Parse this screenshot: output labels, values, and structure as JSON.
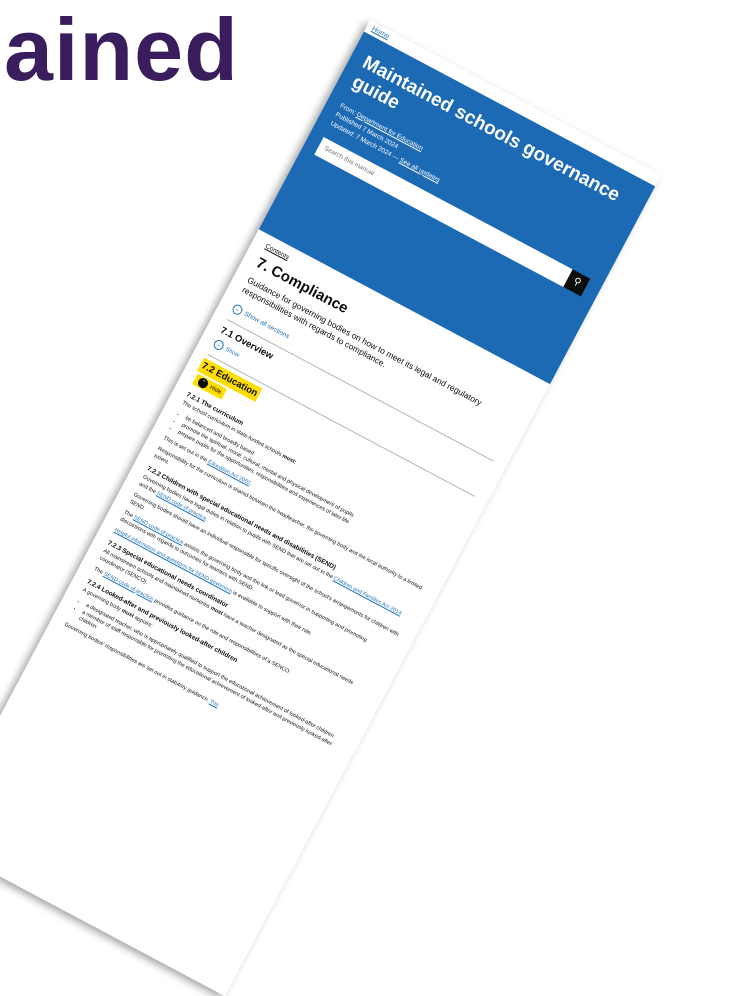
{
  "slide": {
    "title": "ained"
  },
  "page": {
    "home_link": "Home",
    "banner": {
      "title": "Maintained schools governance guide",
      "from_label": "From:",
      "from_org": "Department for Education",
      "published": "Published 7 March 2024",
      "updated_label": "Updated: 7 March 2024 —",
      "see_updates": "See all updates",
      "search_placeholder": "Search this manual"
    },
    "contents_link": "Contents",
    "chapter_title": "7. Compliance",
    "chapter_summary": "Guidance for governing bodies on how to meet its legal and regulatory responsibilities with regards to compliance.",
    "show_all": "Show all sections",
    "sections": [
      {
        "title": "7.1 Overview",
        "control": "Show"
      },
      {
        "title": "7.2 Education",
        "control": "Hide"
      }
    ],
    "s721": {
      "heading": "7.2.1 The curriculum",
      "intro": "The school curriculum in state-funded schools ",
      "must": "must:",
      "bullets": [
        "be balanced and broadly based",
        "promote the spiritual, moral, cultural, mental and physical development of pupils",
        "prepare pupils for the opportunities, responsibilities and experiences of later life"
      ],
      "set_out_pre": "This is set out in the ",
      "set_out_link": "Education Act 2002",
      "set_out_post": ".",
      "responsibility": "Responsibility for the curriculum is shared between the headteacher, the governing body and the local authority to a limited extent."
    },
    "s722": {
      "heading": "7.2.2 Children with special educational needs and disabilities (SEND)",
      "p1_pre": "Governing bodies have legal duties in relation to pupils with SEND that are set out in the ",
      "p1_link1": "Children and Families Act 2014",
      "p1_mid": " and the ",
      "p1_link2": "SEND code of practice",
      "p1_post": ".",
      "p2": "Governing bodies should have an individual responsible for specific oversight of the school's arrangements for children with SEND.",
      "p3_pre": "The ",
      "p3_link": "SEND code of practice",
      "p3_post": " assists the governing body and the link or lead governor in supporting and promoting discussions with regards to outcomes for learners with SEND.",
      "p4_link": "Helpful information and questions for SEND governors",
      "p4_post": " is available to support with their role."
    },
    "s723": {
      "heading": "7.2.3 Special educational needs coordinator",
      "p1_pre": "All mainstream schools and maintained nurseries ",
      "must": "must",
      "p1_post": " have a teacher designated as the special educational needs coordinator (SENCO).",
      "p2_pre": "The ",
      "p2_link": "SEND code of practice",
      "p2_post": " provides guidance on the role and responsibilities of a SENCO."
    },
    "s724": {
      "heading": "7.2.4 Looked-after and previously looked-after children",
      "p1_pre": "A governing body ",
      "must": "must",
      "p1_post": " appoint:",
      "bullets": [
        "a designated teacher, who is appropriately qualified to support the educational achievement of looked-after children",
        "a member of staff responsible for promoting the educational achievement of looked-after and previously looked-after children"
      ],
      "p2_pre": "Governing bodies' responsibilities are set out in statutory guidance. ",
      "p2_link": "The"
    }
  }
}
